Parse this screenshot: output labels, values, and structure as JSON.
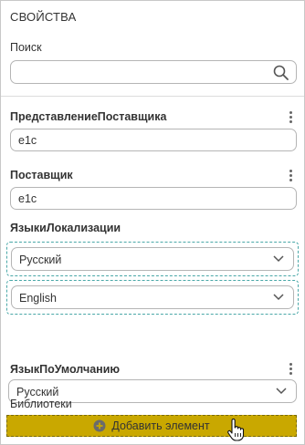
{
  "header": {
    "title": "СВОЙСТВА"
  },
  "search": {
    "label": "Поиск",
    "value": ""
  },
  "fields": {
    "presentation": {
      "label": "ПредставлениеПоставщика",
      "value": "e1c"
    },
    "supplier": {
      "label": "Поставщик",
      "value": "e1c"
    }
  },
  "languages": {
    "label": "ЯзыкиЛокализации",
    "items": [
      "Русский",
      "English"
    ]
  },
  "default_language": {
    "label": "ЯзыкПоУмолчанию",
    "value": "Русский"
  },
  "libraries": {
    "label": "Библиотеки",
    "add_label": "Добавить элемент"
  },
  "colors": {
    "accent": "#c9a800",
    "dashed_border": "#4aa8a8"
  }
}
